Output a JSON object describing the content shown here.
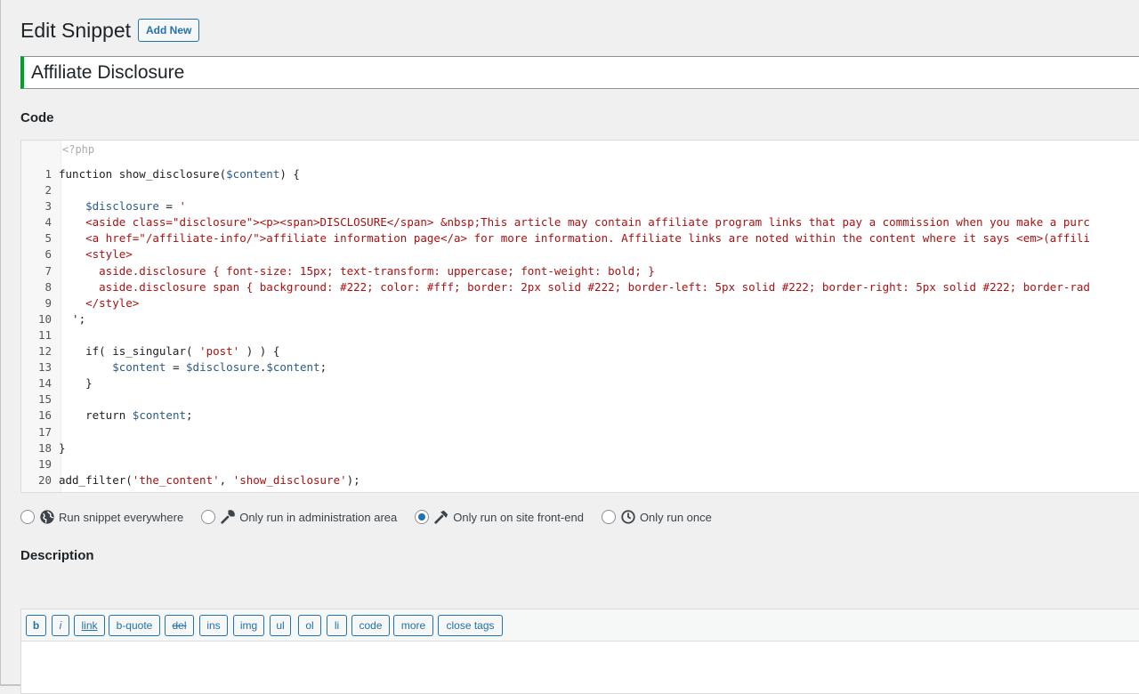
{
  "header": {
    "title": "Edit Snippet",
    "add_new_label": "Add New"
  },
  "snippet": {
    "title": "Affiliate Disclosure"
  },
  "code_section": {
    "heading": "Code",
    "php_open_tag": "<?php",
    "lines": [
      {
        "n": "1",
        "text": "function show_disclosure($content) {"
      },
      {
        "n": "2",
        "text": ""
      },
      {
        "n": "3",
        "text": "    $disclosure = '"
      },
      {
        "n": "4",
        "text": "    <aside class=\"disclosure\"><p><span>DISCLOSURE</span> &nbsp;This article may contain affiliate program links that pay a commission when you make a purc"
      },
      {
        "n": "5",
        "text": "    <a href=\"/affiliate-info/\">affiliate information page</a> for more information. Affiliate links are noted within the content where it says <em>(affili"
      },
      {
        "n": "6",
        "text": "    <style>"
      },
      {
        "n": "7",
        "text": "      aside.disclosure { font-size: 15px; text-transform: uppercase; font-weight: bold; }"
      },
      {
        "n": "8",
        "text": "      aside.disclosure span { background: #222; color: #fff; border: 2px solid #222; border-left: 5px solid #222; border-right: 5px solid #222; border-rad"
      },
      {
        "n": "9",
        "text": "    </style>"
      },
      {
        "n": "10",
        "text": "  ';"
      },
      {
        "n": "11",
        "text": ""
      },
      {
        "n": "12",
        "text": "    if( is_singular( 'post' ) ) {"
      },
      {
        "n": "13",
        "text": "        $content = $disclosure.$content;"
      },
      {
        "n": "14",
        "text": "    }"
      },
      {
        "n": "15",
        "text": ""
      },
      {
        "n": "16",
        "text": "    return $content;"
      },
      {
        "n": "17",
        "text": ""
      },
      {
        "n": "18",
        "text": "}"
      },
      {
        "n": "19",
        "text": ""
      },
      {
        "n": "20",
        "text": "add_filter('the_content', 'show_disclosure');"
      }
    ]
  },
  "run_options": [
    {
      "label": "Run snippet everywhere",
      "icon": "globe-icon",
      "checked": false
    },
    {
      "label": "Only run in administration area",
      "icon": "wrench-icon",
      "checked": false
    },
    {
      "label": "Only run on site front-end",
      "icon": "hammer-icon",
      "checked": true
    },
    {
      "label": "Only run once",
      "icon": "clock-icon",
      "checked": false
    }
  ],
  "description_section": {
    "heading": "Description"
  },
  "quicktags": [
    "b",
    "i",
    "link",
    "b-quote",
    "del",
    "ins",
    "img",
    "ul",
    "ol",
    "li",
    "code",
    "more",
    "close tags"
  ],
  "colors": {
    "accent": "#2271b1",
    "title_border": "#00a32a",
    "code_keyword": "#1d2327",
    "code_variable": "#2a5a8a",
    "code_string": "#a11",
    "code_function": "#1d2327"
  }
}
